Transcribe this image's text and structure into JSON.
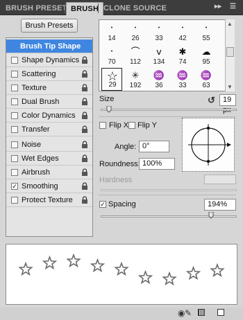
{
  "tabs": [
    {
      "label": "BRUSH PRESETS",
      "active": false
    },
    {
      "label": "BRUSH",
      "active": true
    },
    {
      "label": "CLONE SOURCE",
      "active": false
    }
  ],
  "menu": {
    "expand_icon": "double-chevron-right-icon",
    "menu_icon": "panel-menu-icon"
  },
  "brush_presets_button": "Brush Presets",
  "options": [
    {
      "label": "Brush Tip Shape",
      "checkbox": false,
      "checked": false,
      "lock": false,
      "selected": true
    },
    {
      "label": "Shape Dynamics",
      "checkbox": true,
      "checked": false,
      "lock": true
    },
    {
      "label": "Scattering",
      "checkbox": true,
      "checked": false,
      "lock": true
    },
    {
      "label": "Texture",
      "checkbox": true,
      "checked": false,
      "lock": true
    },
    {
      "label": "Dual Brush",
      "checkbox": true,
      "checked": false,
      "lock": true
    },
    {
      "label": "Color Dynamics",
      "checkbox": true,
      "checked": false,
      "lock": true
    },
    {
      "label": "Transfer",
      "checkbox": true,
      "checked": false,
      "lock": true
    },
    {
      "label": "Noise",
      "checkbox": true,
      "checked": false,
      "lock": true
    },
    {
      "label": "Wet Edges",
      "checkbox": true,
      "checked": false,
      "lock": true
    },
    {
      "label": "Airbrush",
      "checkbox": true,
      "checked": false,
      "lock": true
    },
    {
      "label": "Smoothing",
      "checkbox": true,
      "checked": true,
      "lock": true
    },
    {
      "label": "Protect Texture",
      "checkbox": true,
      "checked": false,
      "lock": true
    }
  ],
  "brushes": [
    {
      "size": "14",
      "glyph": "•"
    },
    {
      "size": "26",
      "glyph": "•"
    },
    {
      "size": "33",
      "glyph": "•"
    },
    {
      "size": "42",
      "glyph": "•"
    },
    {
      "size": "55",
      "glyph": "•"
    },
    {
      "size": "70",
      "glyph": "•"
    },
    {
      "size": "112",
      "glyph": "⌒"
    },
    {
      "size": "134",
      "glyph": "ⅴ"
    },
    {
      "size": "74",
      "glyph": "✱"
    },
    {
      "size": "95",
      "glyph": "☁"
    },
    {
      "size": "29",
      "glyph": "☆",
      "selected": true
    },
    {
      "size": "192",
      "glyph": "✳"
    },
    {
      "size": "36",
      "glyph": "♒"
    },
    {
      "size": "33",
      "glyph": "♒"
    },
    {
      "size": "63",
      "glyph": "♒"
    }
  ],
  "size": {
    "label": "Size",
    "value": "19 px",
    "reset_icon": "reset-size-icon",
    "fill": 0.06
  },
  "flip_x": {
    "label": "Flip X",
    "checked": false
  },
  "flip_y": {
    "label": "Flip Y",
    "checked": false
  },
  "angle": {
    "label": "Angle:",
    "value": "0°"
  },
  "roundness": {
    "label": "Roundness:",
    "value": "100%"
  },
  "hardness": {
    "label": "Hardness",
    "value": "",
    "disabled": true
  },
  "spacing": {
    "label": "Spacing",
    "checked": true,
    "value": "194%",
    "fill": 0.81
  },
  "brush_preview_icon": "brush-angle-preview-icon",
  "stroke_glyph": "☆",
  "stroke_count": 9,
  "bottom_icons": [
    "toggle-preview-icon",
    "brush-tool-icon",
    "grid-icon",
    "create-new-brush-icon"
  ],
  "colors": {
    "selection": "#3f86e0",
    "panel": "#d6d6d6",
    "tabbar": "#3d3d3d"
  }
}
